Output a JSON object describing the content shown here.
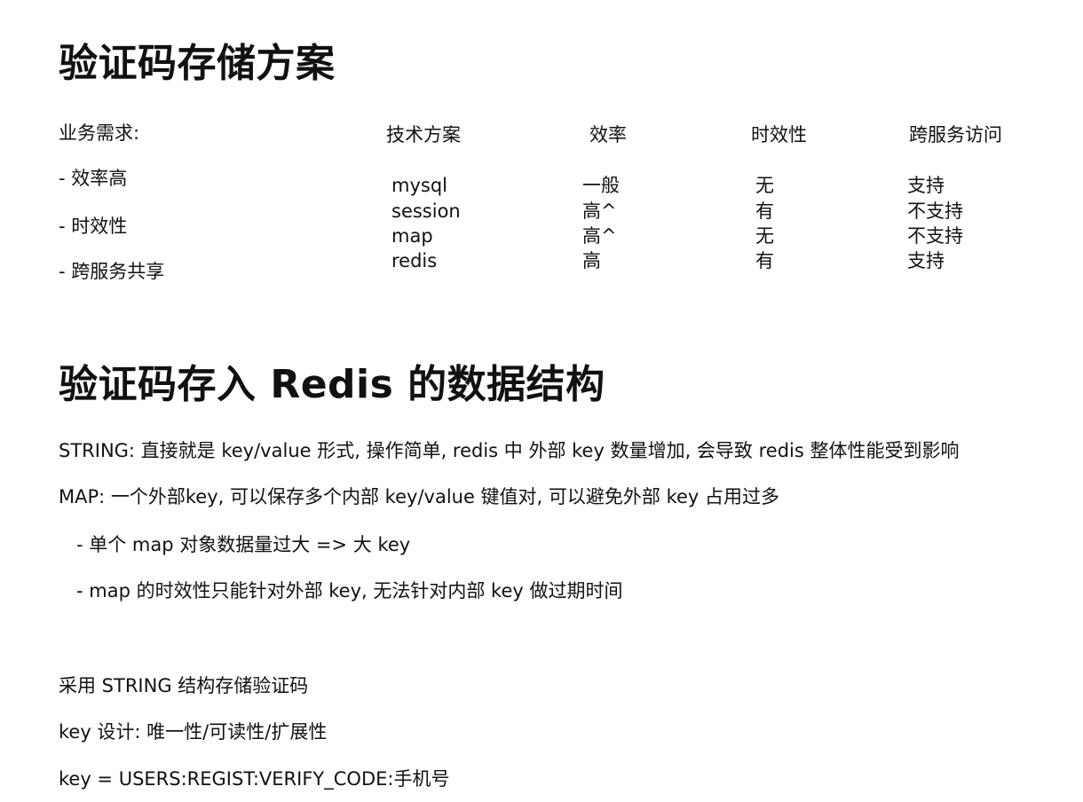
{
  "section1": {
    "heading": "验证码存储方案",
    "requirements": {
      "title": "业务需求:",
      "items": [
        "- 效率高",
        "- 时效性",
        "- 跨服务共享"
      ]
    },
    "table": {
      "headers": [
        "技术方案",
        "效率",
        "时效性",
        "跨服务访问"
      ],
      "rows": [
        [
          "mysql",
          "一般",
          "无",
          "支持"
        ],
        [
          "session",
          "高^",
          "有",
          "不支持"
        ],
        [
          "map",
          "高^",
          "无",
          "不支持"
        ],
        [
          "redis",
          "高",
          "有",
          "支持"
        ]
      ]
    }
  },
  "section2": {
    "heading": "验证码存入 Redis 的数据结构",
    "paragraphs": [
      "STRING: 直接就是 key/value 形式, 操作简单, redis 中 外部 key 数量增加, 会导致 redis 整体性能受到影响",
      "MAP: 一个外部key, 可以保存多个内部 key/value 键值对, 可以避免外部 key 占用过多",
      "- 单个 map 对象数据量过大 => 大 key",
      "- map 的时效性只能针对外部 key, 无法针对内部 key 做过期时间",
      "采用 STRING 结构存储验证码",
      "key 设计: 唯一性/可读性/扩展性",
      "key = USERS:REGIST:VERIFY_CODE:手机号"
    ]
  }
}
